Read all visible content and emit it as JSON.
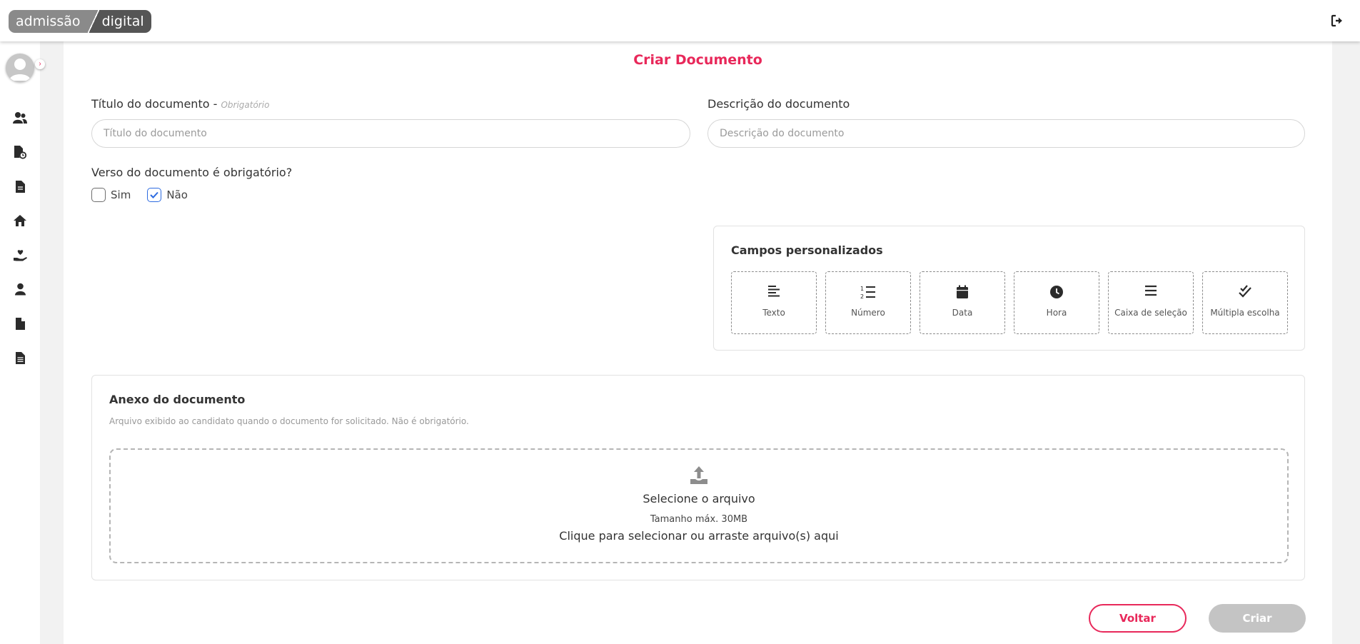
{
  "header": {
    "logo_part1": "admissão",
    "logo_part2": "digital",
    "logout_icon": "sign-out-icon"
  },
  "sidebar": {
    "avatar_icon": "user-avatar-icon",
    "expand_icon": "chevron-right-icon",
    "items": [
      {
        "icon": "users-icon"
      },
      {
        "icon": "file-clock-icon"
      },
      {
        "icon": "file-text-icon"
      },
      {
        "icon": "home-icon"
      },
      {
        "icon": "hand-heart-icon"
      },
      {
        "icon": "user-icon"
      },
      {
        "icon": "file-icon"
      },
      {
        "icon": "file-list-icon"
      }
    ]
  },
  "page": {
    "title": "Criar Documento"
  },
  "form": {
    "title_label": "Título do documento - ",
    "title_required": "Obrigatório",
    "title_placeholder": "Título do documento",
    "title_value": "",
    "description_label": "Descrição do documento",
    "description_placeholder": "Descrição do documento",
    "description_value": "",
    "back_required_question": "Verso do documento é obrigatório?",
    "option_yes": "Sim",
    "option_yes_checked": false,
    "option_no": "Não",
    "option_no_checked": true
  },
  "custom_fields": {
    "title": "Campos personalizados",
    "types": [
      {
        "label": "Texto",
        "icon": "align-left-icon"
      },
      {
        "label": "Número",
        "icon": "list-ol-icon"
      },
      {
        "label": "Data",
        "icon": "calendar-icon"
      },
      {
        "label": "Hora",
        "icon": "clock-icon"
      },
      {
        "label": "Caixa de seleção",
        "icon": "menu-lines-icon"
      },
      {
        "label": "Múltipla escolha",
        "icon": "double-check-icon"
      }
    ]
  },
  "attachment": {
    "title": "Anexo do documento",
    "description": "Arquivo exibido ao candidato quando o documento for solicitado. Não é obrigatório.",
    "dropzone_title": "Selecione o arquivo",
    "max_size": "Tamanho máx. 30MB",
    "hint": "Clique para selecionar ou arraste arquivo(s) aqui",
    "icon": "upload-icon"
  },
  "actions": {
    "back_label": "Voltar",
    "create_label": "Criar"
  },
  "colors": {
    "accent": "#e8285a",
    "check_blue": "#2d6be0",
    "disabled_button": "#c4c4c4"
  }
}
